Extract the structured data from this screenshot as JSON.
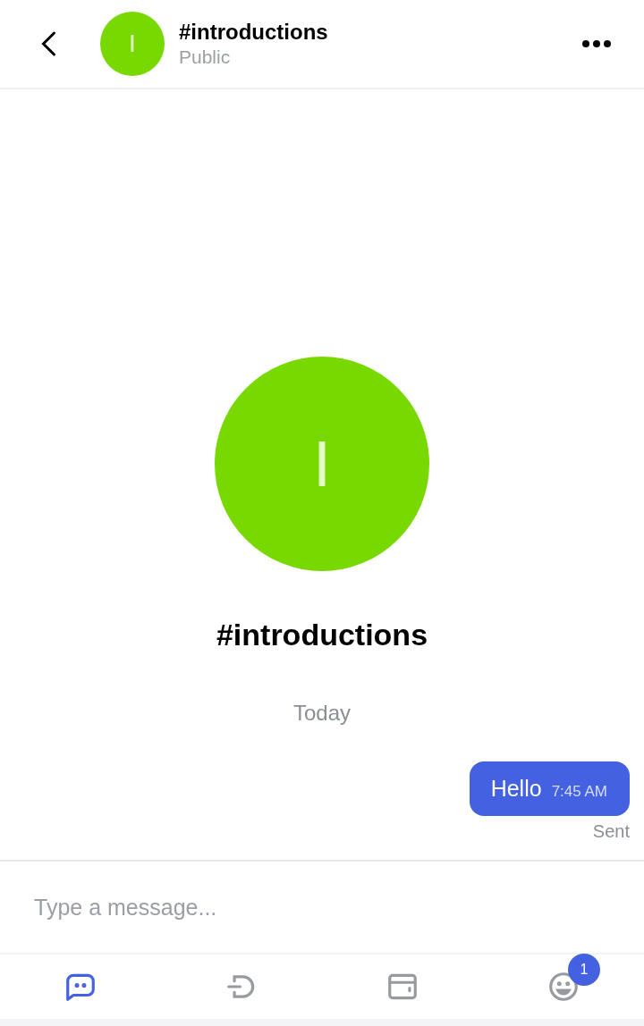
{
  "header": {
    "avatar_letter": "I",
    "title": "#introductions",
    "subtitle": "Public"
  },
  "channel": {
    "avatar_letter": "I",
    "name": "#introductions"
  },
  "date_divider": "Today",
  "messages": [
    {
      "text": "Hello",
      "time": "7:45 AM",
      "status": "Sent"
    }
  ],
  "composer": {
    "placeholder": "Type a message..."
  },
  "nav": [
    {
      "kind": "chat",
      "selected": true
    },
    {
      "kind": "logout",
      "selected": false
    },
    {
      "kind": "wallet",
      "selected": false
    },
    {
      "kind": "face",
      "selected": false,
      "badge": "1"
    }
  ]
}
